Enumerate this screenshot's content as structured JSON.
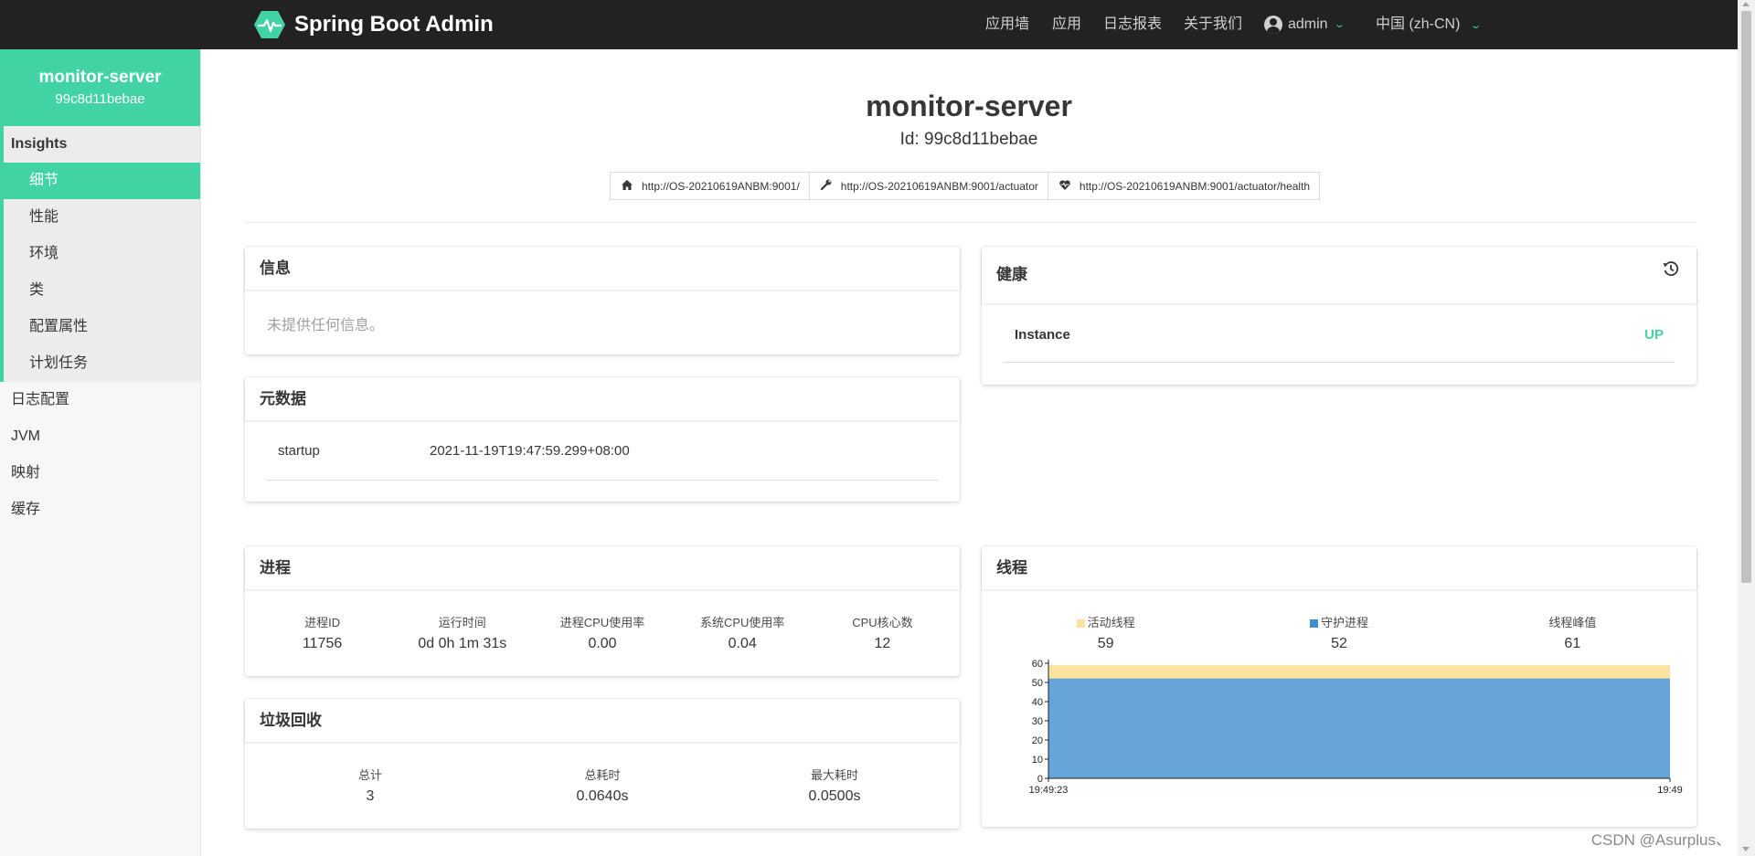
{
  "navbar": {
    "brand": "Spring Boot Admin",
    "links": [
      "应用墙",
      "应用",
      "日志报表",
      "关于我们"
    ],
    "user": "admin",
    "language": "中国 (zh-CN)"
  },
  "sidebar": {
    "app_name": "monitor-server",
    "app_id": "99c8d11bebae",
    "insights_label": "Insights",
    "insights_items": [
      "细节",
      "性能",
      "环境",
      "类",
      "配置属性",
      "计划任务"
    ],
    "items": [
      "日志配置",
      "JVM",
      "映射",
      "缓存"
    ]
  },
  "header": {
    "title": "monitor-server",
    "id_line": "Id: 99c8d11bebae",
    "endpoints": [
      {
        "icon": "home-icon",
        "url": "http://OS-20210619ANBM:9001/"
      },
      {
        "icon": "wrench-icon",
        "url": "http://OS-20210619ANBM:9001/actuator"
      },
      {
        "icon": "heartbeat-icon",
        "url": "http://OS-20210619ANBM:9001/actuator/health"
      }
    ]
  },
  "info": {
    "title": "信息",
    "empty": "未提供任何信息。"
  },
  "metadata": {
    "title": "元数据",
    "rows": [
      {
        "key": "startup",
        "value": "2021-11-19T19:47:59.299+08:00"
      }
    ]
  },
  "health": {
    "title": "健康",
    "rows": [
      {
        "name": "Instance",
        "status": "UP"
      }
    ]
  },
  "process": {
    "title": "进程",
    "stats": [
      {
        "label": "进程ID",
        "value": "11756"
      },
      {
        "label": "运行时间",
        "value": "0d 0h 1m 31s"
      },
      {
        "label": "进程CPU使用率",
        "value": "0.00"
      },
      {
        "label": "系统CPU使用率",
        "value": "0.04"
      },
      {
        "label": "CPU核心数",
        "value": "12"
      }
    ]
  },
  "gc": {
    "title": "垃圾回收",
    "stats": [
      {
        "label": "总计",
        "value": "3"
      },
      {
        "label": "总耗时",
        "value": "0.0640s"
      },
      {
        "label": "最大耗时",
        "value": "0.0500s"
      }
    ]
  },
  "threads": {
    "title": "线程",
    "stats": [
      {
        "label": "活动线程",
        "value": "59"
      },
      {
        "label": "守护进程",
        "value": "52"
      },
      {
        "label": "线程峰值",
        "value": "61"
      }
    ]
  },
  "chart_data": {
    "type": "area",
    "series": [
      {
        "name": "守护进程",
        "values": [
          52,
          52
        ],
        "color": "#67a4d9"
      },
      {
        "name": "活动线程",
        "values": [
          59,
          59
        ],
        "color": "#fbe29f"
      }
    ],
    "x": [
      "19:49:23",
      "19:49"
    ],
    "yticks": [
      "0",
      "10",
      "20",
      "30",
      "40",
      "50",
      "60"
    ],
    "ylim": [
      0,
      60
    ]
  },
  "colors": {
    "accent": "#42d3a5",
    "up": "#42d3a5",
    "navbar": "#222222"
  },
  "watermark": "CSDN @Asurplus、"
}
